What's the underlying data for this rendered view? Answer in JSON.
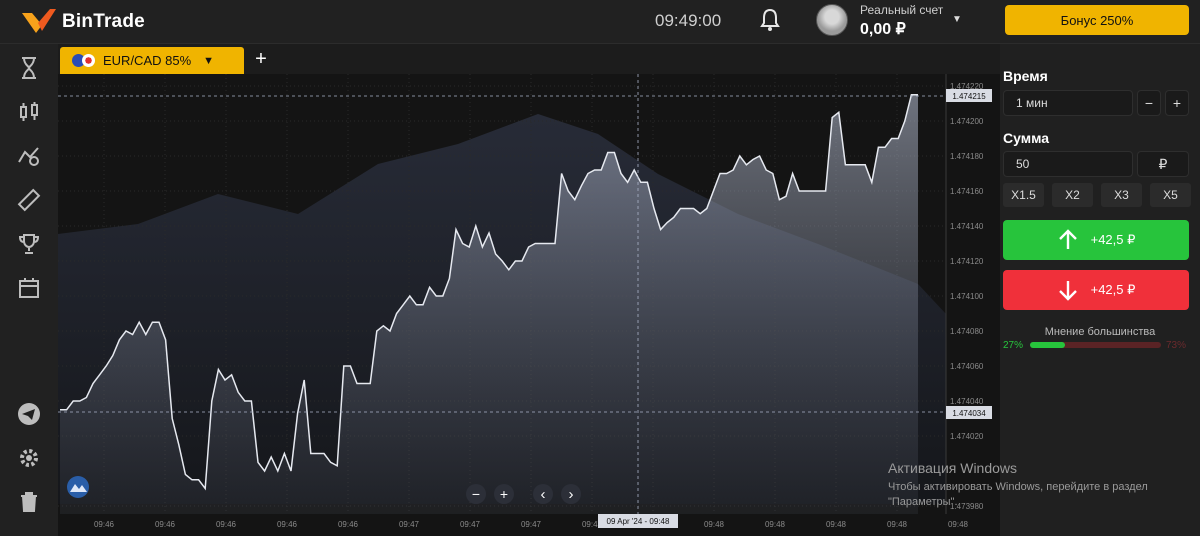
{
  "header": {
    "logo_text": "BinTrade",
    "clock": "09:49:00",
    "account_label": "Реальный счет",
    "account_balance": "0,00 ₽",
    "bonus_button": "Бонус 250%"
  },
  "sidebar": {
    "icons": [
      "hourglass-icon",
      "candles-icon",
      "indicators-icon",
      "ruler-icon",
      "trophy-icon",
      "calendar-icon",
      "telegram-icon",
      "settings-icon",
      "trash-icon"
    ]
  },
  "tabs": {
    "asset": "EUR/CAD 85%"
  },
  "chart": {
    "current_price_label": "1.474215",
    "open_price_label": "1.474034",
    "crosshair_time_label": "09 Apr '24 - 09:48",
    "price_ticks": [
      "1.474220",
      "1.474200",
      "1.474180",
      "1.474160",
      "1.474140",
      "1.474120",
      "1.474100",
      "1.474080",
      "1.474060",
      "1.474040",
      "1.474020",
      "1.473980"
    ],
    "time_ticks": [
      "09:46",
      "09:46",
      "09:46",
      "09:46",
      "09:46",
      "09:47",
      "09:47",
      "09:47",
      "09:47",
      "09:47",
      "09:48",
      "09:48",
      "09:48",
      "09:48",
      "09:48"
    ],
    "zoom_out": "−",
    "zoom_in": "+",
    "prev": "‹",
    "next": "›"
  },
  "panel": {
    "time_label": "Время",
    "time_value": "1 мин",
    "minus": "−",
    "plus": "+",
    "amount_label": "Сумма",
    "amount_value": "50",
    "currency": "₽",
    "multipliers": [
      "X1.5",
      "X2",
      "X3",
      "X5"
    ],
    "up_payout": "+42,5 ₽",
    "down_payout": "+42,5 ₽",
    "sentiment_label": "Мнение большинства",
    "sentiment_up": "27%",
    "sentiment_down": "73%",
    "sentiment_up_fraction": 0.27
  },
  "os_notice": {
    "title": "Активация Windows",
    "body": "Чтобы активировать Windows, перейдите в раздел \"Параметры\"."
  },
  "colors": {
    "accent": "#f0b400",
    "up": "#27c43c",
    "down": "#f0303a"
  },
  "chart_data": {
    "type": "area",
    "y_ticks": [
      1.47422,
      1.4742,
      1.47418,
      1.47416,
      1.47414,
      1.47412,
      1.4741,
      1.47408,
      1.47406,
      1.47404,
      1.47402,
      1.47398
    ],
    "values": [
      1.474035,
      1.474035,
      1.47404,
      1.47404,
      1.474042,
      1.47405,
      1.474055,
      1.47406,
      1.474066,
      1.474075,
      1.47408,
      1.474078,
      1.474085,
      1.474078,
      1.474085,
      1.474085,
      1.474075,
      1.47403,
      1.474015,
      1.473998,
      1.473995,
      1.473995,
      1.47399,
      1.47404,
      1.474058,
      1.474052,
      1.474055,
      1.474045,
      1.47404,
      1.47404,
      1.474005,
      1.474,
      1.474008,
      1.474,
      1.47401,
      1.474,
      1.474033,
      1.474052,
      1.47401,
      1.47401,
      1.47401,
      1.474005,
      1.474003,
      1.47406,
      1.47406,
      1.47405,
      1.47405,
      1.47405,
      1.47408,
      1.474083,
      1.47408,
      1.47409,
      1.474095,
      1.4741,
      1.474095,
      1.474095,
      1.474105,
      1.4741,
      1.4741,
      1.47411,
      1.474138,
      1.47413,
      1.474128,
      1.47414,
      1.474128,
      1.474136,
      1.474124,
      1.47412,
      1.474115,
      1.47412,
      1.47412,
      1.474128,
      1.47413,
      1.47413,
      1.47413,
      1.47413,
      1.47417,
      1.47416,
      1.474155,
      1.474163,
      1.47417,
      1.474172,
      1.474172,
      1.474182,
      1.474182,
      1.47417,
      1.474165,
      1.474172,
      1.474165,
      1.474165,
      1.47415,
      1.474138,
      1.474142,
      1.474145,
      1.47415,
      1.47415,
      1.47415,
      1.474147,
      1.47415,
      1.47416,
      1.47417,
      1.47417,
      1.474172,
      1.47418,
      1.474175,
      1.474178,
      1.47418,
      1.474172,
      1.47417,
      1.474155,
      1.474157,
      1.47417,
      1.47416,
      1.47416,
      1.47416,
      1.47416,
      1.47416,
      1.474202,
      1.474205,
      1.474175,
      1.474175,
      1.474175,
      1.474175,
      1.474165,
      1.474185,
      1.474185,
      1.47419,
      1.47419,
      1.4742,
      1.474215,
      1.474215
    ]
  }
}
